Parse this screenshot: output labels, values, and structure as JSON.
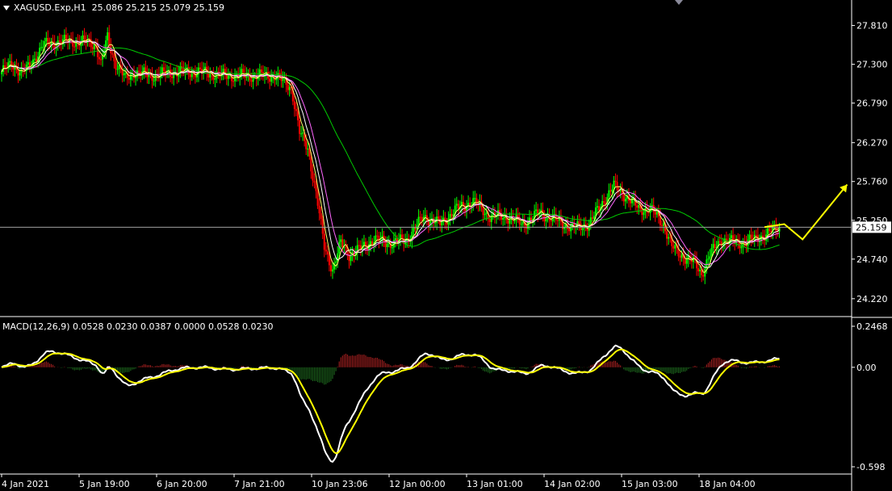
{
  "header": {
    "symbol": "XAGUSD.Exp,H1",
    "ohlc": "25.086 25.215 25.079 25.159"
  },
  "macd_header": "MACD(12,26,9) 0.0528 0.0230 0.0387 0.0000 0.0528 0.0230",
  "price_marker": "25.159",
  "colors": {
    "background": "#000000",
    "bull": "#00ff00",
    "bear": "#ff0000",
    "ma_fast": "#ffff66",
    "ma_mid": "#ff66ff",
    "ma_white": "#ffffff",
    "ma_slow": "#00cc00",
    "macd_line": "#ffffff",
    "signal_line": "#ffff00",
    "arrow": "#ffff00"
  },
  "chart_data": [
    {
      "type": "candlestick",
      "title": "XAGUSD.Exp,H1",
      "y_ticks": [
        "27.810",
        "27.300",
        "26.790",
        "26.270",
        "25.760",
        "25.250",
        "24.740",
        "24.220"
      ],
      "x_ticks": [
        "4 Jan 2021",
        "5 Jan 19:00",
        "6 Jan 20:00",
        "7 Jan 21:00",
        "10 Jan 23:06",
        "12 Jan 00:00",
        "13 Jan 01:00",
        "14 Jan 02:00",
        "15 Jan 03:00",
        "18 Jan 04:00"
      ],
      "ylim": [
        24.07,
        28.06
      ],
      "close_anchors": [
        [
          0,
          27.2
        ],
        [
          6,
          27.3
        ],
        [
          12,
          27.2
        ],
        [
          16,
          27.25
        ],
        [
          25,
          27.55
        ],
        [
          35,
          27.6
        ],
        [
          50,
          27.6
        ],
        [
          57,
          27.55
        ],
        [
          60,
          27.3
        ],
        [
          64,
          27.65
        ],
        [
          68,
          27.35
        ],
        [
          75,
          27.1
        ],
        [
          80,
          27.2
        ],
        [
          90,
          27.15
        ],
        [
          105,
          27.2
        ],
        [
          120,
          27.2
        ],
        [
          135,
          27.15
        ],
        [
          150,
          27.15
        ],
        [
          165,
          27.15
        ],
        [
          175,
          27.0
        ],
        [
          180,
          26.4
        ],
        [
          185,
          26.2
        ],
        [
          190,
          25.6
        ],
        [
          195,
          24.9
        ],
        [
          200,
          24.6
        ],
        [
          205,
          24.95
        ],
        [
          210,
          24.8
        ],
        [
          215,
          24.85
        ],
        [
          225,
          25.0
        ],
        [
          235,
          24.95
        ],
        [
          245,
          25.0
        ],
        [
          255,
          25.3
        ],
        [
          265,
          25.2
        ],
        [
          275,
          25.4
        ],
        [
          285,
          25.5
        ],
        [
          295,
          25.3
        ],
        [
          305,
          25.3
        ],
        [
          315,
          25.2
        ],
        [
          325,
          25.35
        ],
        [
          335,
          25.25
        ],
        [
          345,
          25.15
        ],
        [
          355,
          25.2
        ],
        [
          362,
          25.45
        ],
        [
          370,
          25.7
        ],
        [
          378,
          25.55
        ],
        [
          385,
          25.4
        ],
        [
          392,
          25.4
        ],
        [
          400,
          25.2
        ],
        [
          405,
          24.9
        ],
        [
          410,
          24.8
        ],
        [
          418,
          24.7
        ],
        [
          423,
          24.55
        ],
        [
          428,
          24.8
        ],
        [
          435,
          25.0
        ],
        [
          445,
          24.95
        ],
        [
          455,
          25.0
        ],
        [
          465,
          25.1
        ],
        [
          470,
          25.159
        ]
      ],
      "ma_periods": {
        "fast": 5,
        "mid": 14,
        "white": 9,
        "slow": 55
      },
      "current_price": 25.159,
      "forecast_arrow": [
        [
          461,
          25.16
        ],
        [
          473,
          25.2
        ],
        [
          484,
          25.0
        ],
        [
          511,
          25.72
        ]
      ]
    },
    {
      "type": "macd",
      "title": "MACD(12,26,9)",
      "y_ticks": [
        "0.2468",
        "0.00",
        "-0.598"
      ],
      "ylim": [
        -0.598,
        0.2468
      ],
      "params": {
        "fast": 12,
        "slow": 26,
        "signal": 9
      },
      "values": {
        "macd": 0.0528,
        "signal": 0.023
      }
    }
  ]
}
